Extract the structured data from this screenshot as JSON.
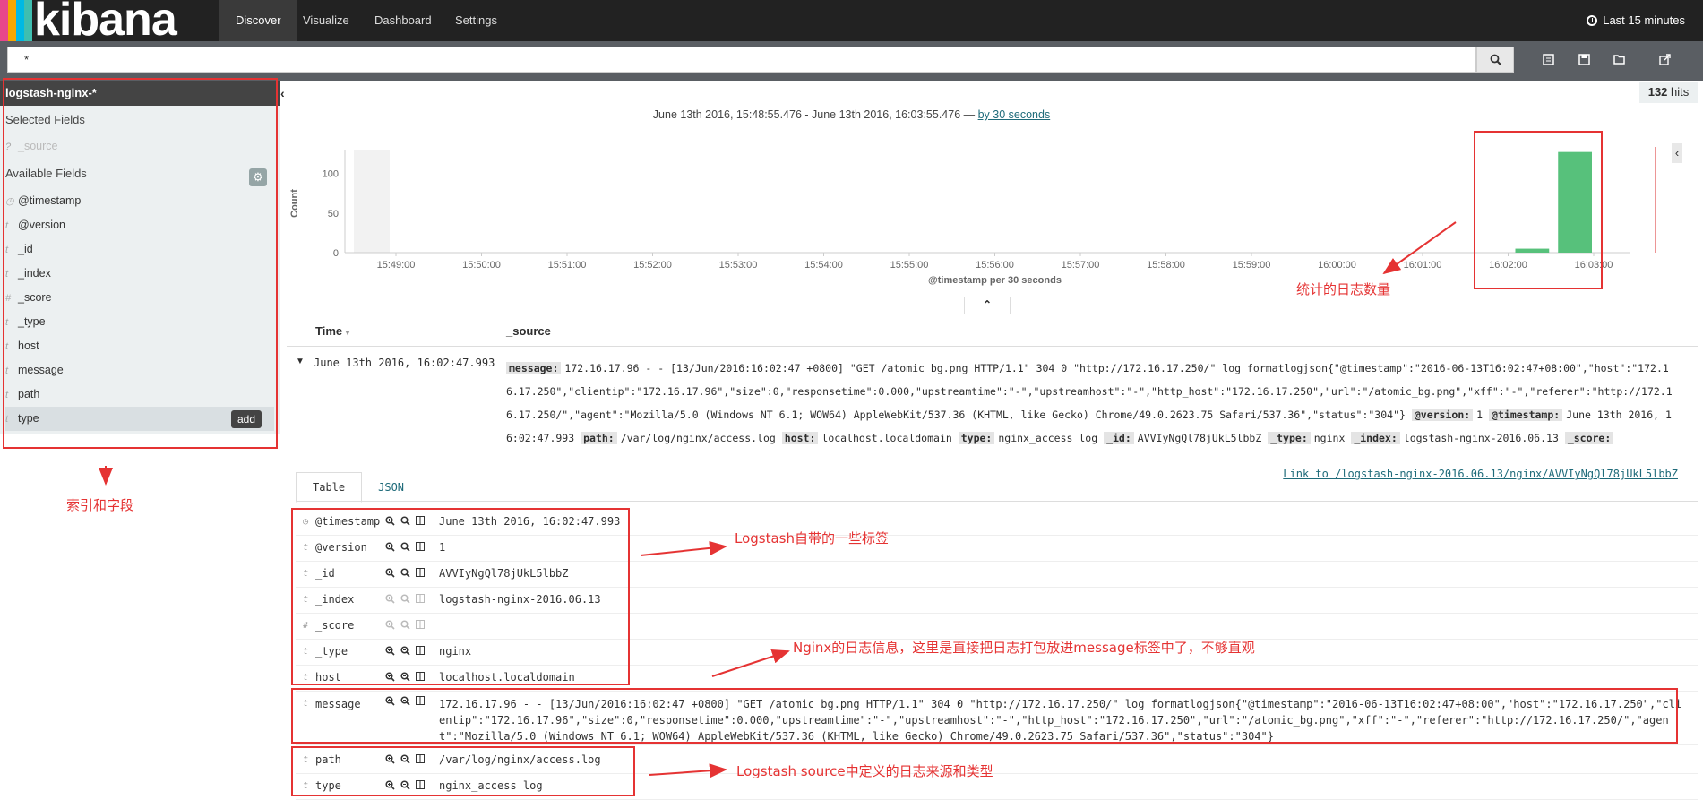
{
  "nav": {
    "logo": "kibana",
    "logo_colors": [
      "#e8478b",
      "#f5a700",
      "#00b9e4",
      "#3fbeb0"
    ],
    "tabs": [
      {
        "label": "Discover",
        "active": true
      },
      {
        "label": "Visualize",
        "active": false
      },
      {
        "label": "Dashboard",
        "active": false
      },
      {
        "label": "Settings",
        "active": false
      }
    ],
    "time_label": "Last 15 minutes"
  },
  "search": {
    "value": "*"
  },
  "sidebar": {
    "index_pattern": "logstash-nginx-*",
    "selected_header": "Selected Fields",
    "selected_fields": [
      {
        "icon": "?",
        "name": "_source"
      }
    ],
    "available_header": "Available Fields",
    "available_fields": [
      {
        "icon": "clock",
        "name": "@timestamp"
      },
      {
        "icon": "t",
        "name": "@version"
      },
      {
        "icon": "t",
        "name": "_id"
      },
      {
        "icon": "t",
        "name": "_index"
      },
      {
        "icon": "#",
        "name": "_score"
      },
      {
        "icon": "t",
        "name": "_type"
      },
      {
        "icon": "t",
        "name": "host"
      },
      {
        "icon": "t",
        "name": "message"
      },
      {
        "icon": "t",
        "name": "path"
      },
      {
        "icon": "t",
        "name": "type"
      }
    ],
    "add_label": "add"
  },
  "hits": {
    "count": "132",
    "label": "hits"
  },
  "range": {
    "text": "June 13th 2016, 15:48:55.476 - June 13th 2016, 16:03:55.476 — ",
    "interval": "by 30 seconds"
  },
  "chart_data": {
    "type": "bar",
    "ylabel": "Count",
    "xlabel": "@timestamp per 30 seconds",
    "y_ticks": [
      0,
      50,
      100
    ],
    "ylim": [
      0,
      130
    ],
    "x_ticks": [
      "15:49:00",
      "15:50:00",
      "15:51:00",
      "15:52:00",
      "15:53:00",
      "15:54:00",
      "15:55:00",
      "15:56:00",
      "15:57:00",
      "15:58:00",
      "15:59:00",
      "16:00:00",
      "16:01:00",
      "16:02:00",
      "16:03:00"
    ],
    "bars": [
      {
        "x": "16:02:30",
        "value": 5
      },
      {
        "x": "16:03:00",
        "value": 127
      }
    ],
    "bar_color": "#57c17b",
    "grid": false
  },
  "table": {
    "time_header": "Time",
    "source_header": "_source",
    "row_time": "June 13th 2016, 16:02:47.993",
    "source_pairs": [
      {
        "k": "message:",
        "v": "172.16.17.96 - - [13/Jun/2016:16:02:47 +0800] \"GET /atomic_bg.png HTTP/1.1\" 304 0 \"http://172.16.17.250/\" log_formatlogjson{\"@timestamp\":\"2016-06-13T16:02:47+08:00\",\"host\":\"172.16.17.250\",\"clientip\":\"172.16.17.96\",\"size\":0,\"responsetime\":0.000,\"upstreamtime\":\"-\",\"upstreamhost\":\"-\",\"http_host\":\"172.16.17.250\",\"url\":\"/atomic_bg.png\",\"xff\":\"-\",\"referer\":\"http://172.16.17.250/\",\"agent\":\"Mozilla/5.0 (Windows NT 6.1; WOW64) AppleWebKit/537.36 (KHTML, like Gecko) Chrome/49.0.2623.75 Safari/537.36\",\"status\":\"304\"}"
      },
      {
        "k": "@version:",
        "v": "1"
      },
      {
        "k": "@timestamp:",
        "v": "June 13th 2016, 16:02:47.993"
      },
      {
        "k": "path:",
        "v": "/var/log/nginx/access.log"
      },
      {
        "k": "host:",
        "v": "localhost.localdomain"
      },
      {
        "k": "type:",
        "v": "nginx_access log"
      },
      {
        "k": "_id:",
        "v": "AVVIyNgQl78jUkL5lbbZ"
      },
      {
        "k": "_type:",
        "v": "nginx"
      },
      {
        "k": "_index:",
        "v": "logstash-nginx-2016.06.13"
      },
      {
        "k": "_score:",
        "v": ""
      }
    ]
  },
  "detail": {
    "tabs": [
      "Table",
      "JSON"
    ],
    "link": "Link to /logstash-nginx-2016.06.13/nginx/AVVIyNgQl78jUkL5lbbZ",
    "rows": [
      {
        "icon": "clock",
        "name": "@timestamp",
        "value": "June 13th 2016, 16:02:47.993"
      },
      {
        "icon": "t",
        "name": "@version",
        "value": "1"
      },
      {
        "icon": "t",
        "name": "_id",
        "value": "AVVIyNgQl78jUkL5lbbZ"
      },
      {
        "icon": "t",
        "name": "_index",
        "value": "logstash-nginx-2016.06.13"
      },
      {
        "icon": "#",
        "name": "_score",
        "value": ""
      },
      {
        "icon": "t",
        "name": "_type",
        "value": "nginx"
      },
      {
        "icon": "t",
        "name": "host",
        "value": "localhost.localdomain"
      },
      {
        "icon": "t",
        "name": "message",
        "value": "172.16.17.96 - - [13/Jun/2016:16:02:47 +0800] \"GET /atomic_bg.png HTTP/1.1\" 304 0 \"http://172.16.17.250/\" log_formatlogjson{\"@timestamp\":\"2016-06-13T16:02:47+08:00\",\"host\":\"172.16.17.250\",\"clientip\":\"172.16.17.96\",\"size\":0,\"responsetime\":0.000,\"upstreamtime\":\"-\",\"upstreamhost\":\"-\",\"http_host\":\"172.16.17.250\",\"url\":\"/atomic_bg.png\",\"xff\":\"-\",\"referer\":\"http://172.16.17.250/\",\"agent\":\"Mozilla/5.0 (Windows NT 6.1; WOW64) AppleWebKit/537.36 (KHTML, like Gecko) Chrome/49.0.2623.75 Safari/537.36\",\"status\":\"304\"}"
      },
      {
        "icon": "t",
        "name": "path",
        "value": "/var/log/nginx/access.log"
      },
      {
        "icon": "t",
        "name": "type",
        "value": "nginx_access log"
      }
    ]
  },
  "annotations": {
    "fields": "索引和字段",
    "count": "统计的日志数量",
    "logstash_tags": "Logstash自带的一些标签",
    "nginx_msg": "Nginx的日志信息，这里是直接把日志打包放进message标签中了，不够直观",
    "logstash_source": "Logstash source中定义的日志来源和类型"
  }
}
